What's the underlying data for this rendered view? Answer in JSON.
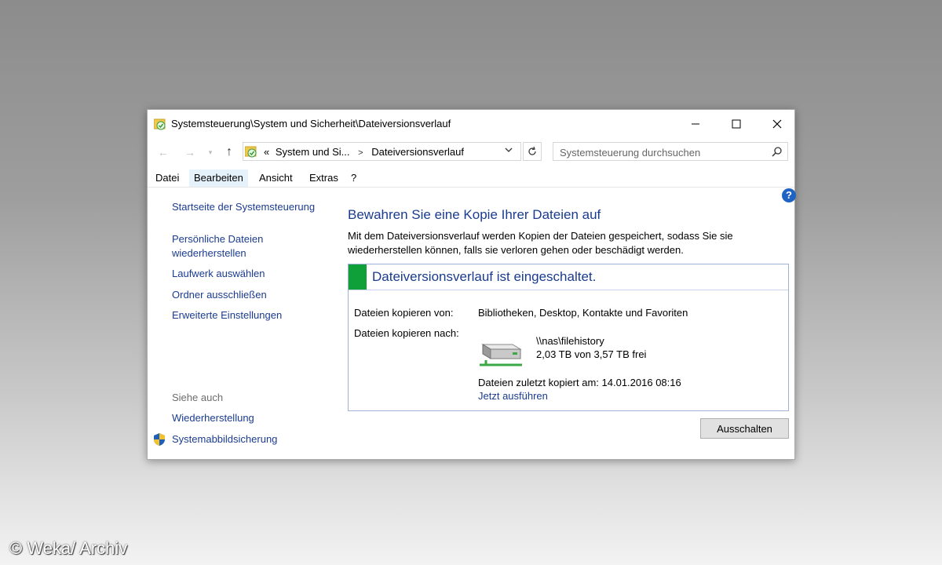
{
  "window": {
    "title": "Systemsteuerung\\System und Sicherheit\\Dateiversionsverlauf"
  },
  "address_bar": {
    "prefix": "«",
    "crumbs": [
      "System und Si...",
      "Dateiversionsverlauf"
    ]
  },
  "search": {
    "placeholder": "Systemsteuerung durchsuchen"
  },
  "menu": {
    "items": [
      "Datei",
      "Bearbeiten",
      "Ansicht",
      "Extras",
      "?"
    ],
    "highlighted": "Bearbeiten"
  },
  "sidebar": {
    "home": "Startseite der Systemsteuerung",
    "restore_line1": "Persönliche Dateien",
    "restore_line2": "wiederherstellen",
    "select_drive": "Laufwerk auswählen",
    "exclude_folders": "Ordner ausschließen",
    "advanced": "Erweiterte Einstellungen",
    "see_also": "Siehe auch",
    "recovery": "Wiederherstellung",
    "system_image": "Systemabbildsicherung"
  },
  "main": {
    "heading": "Bewahren Sie eine Kopie Ihrer Dateien auf",
    "description": "Mit dem Dateiversionsverlauf werden Kopien der Dateien gespeichert, sodass Sie sie wiederherstellen können, falls sie verloren gehen oder beschädigt werden.",
    "status_title": "Dateiversionsverlauf ist eingeschaltet.",
    "copy_from_label": "Dateien kopieren von:",
    "copy_from_value": "Bibliotheken, Desktop, Kontakte und Favoriten",
    "copy_to_label": "Dateien kopieren nach:",
    "drive_path": "\\\\nas\\filehistory",
    "drive_space": "2,03 TB von 3,57 TB frei",
    "last_copied": "Dateien zuletzt kopiert am: 14.01.2016 08:16",
    "run_now": "Jetzt ausführen",
    "turn_off_button": "Ausschalten"
  },
  "watermark": "© Weka/ Archiv",
  "colors": {
    "link": "#1a3b8f",
    "status_green": "#10a03a",
    "box_border": "#9fb1d6",
    "help_blue": "#1e63c4"
  }
}
